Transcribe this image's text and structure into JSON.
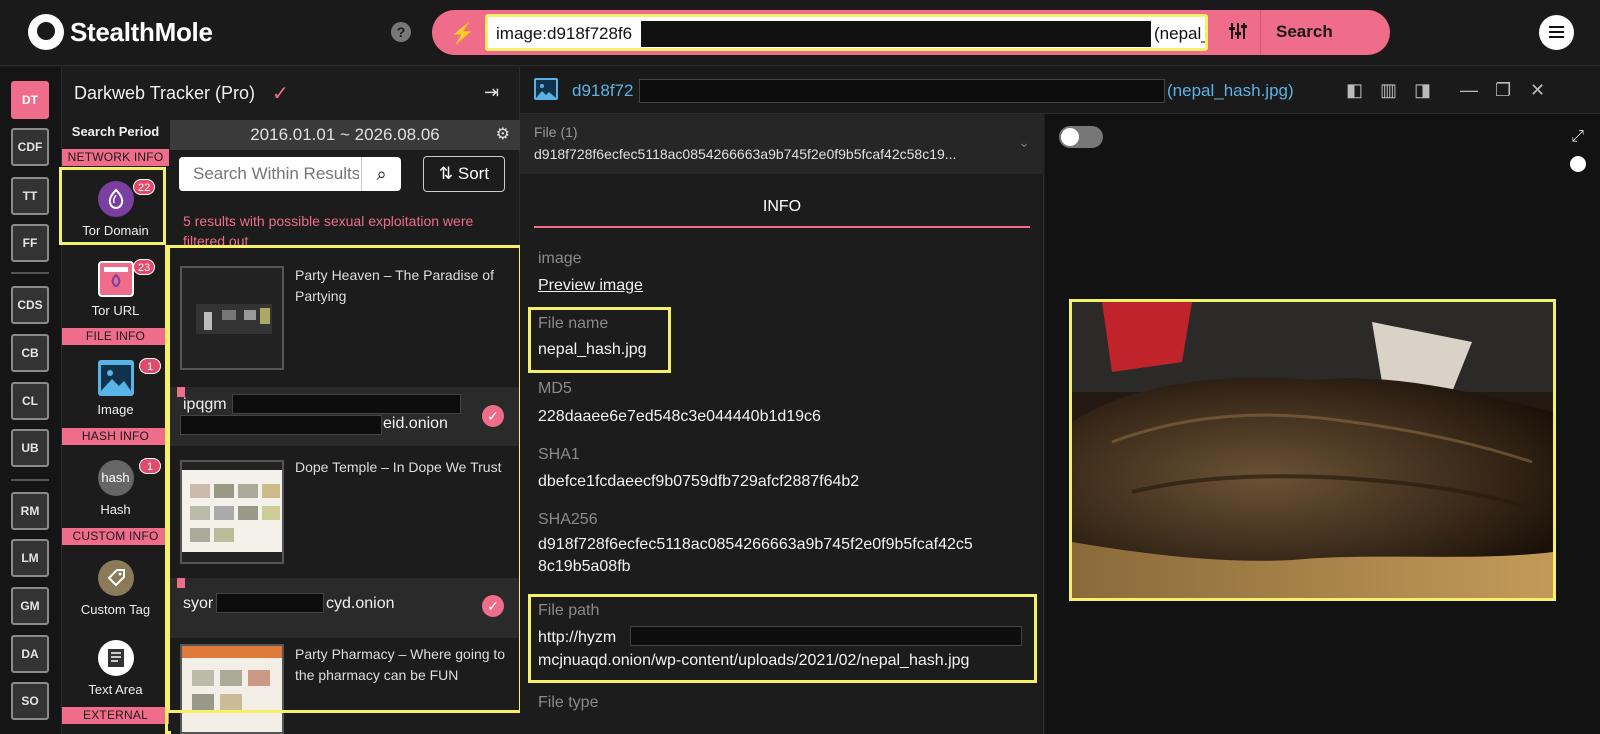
{
  "app": {
    "name": "StealthMole",
    "help_icon": "help-circle-icon",
    "menu_icon": "hamburger-icon"
  },
  "search": {
    "query_visible_start": "image:d918f728f6",
    "query_visible_end": "(nepal_l",
    "button": "Search",
    "mode_icon": "lightning-icon",
    "filter_icon": "sliders-icon"
  },
  "leftnav": [
    "DT",
    "CDF",
    "TT",
    "FF",
    "CDS",
    "CB",
    "CL",
    "UB",
    "RM",
    "LM",
    "GM",
    "DA",
    "SO"
  ],
  "panel": {
    "title": "Darkweb Tracker (Pro)",
    "search_period_label": "Search Period",
    "search_period": "2016.01.01 ~ 2026.08.06",
    "sections": {
      "network": "NETWORK INFO",
      "file": "FILE INFO",
      "hash": "HASH INFO",
      "custom": "CUSTOM INFO",
      "external": "EXTERNAL"
    },
    "categories": [
      {
        "label": "Tor Domain",
        "count": "22",
        "icon": "tor-onion-icon"
      },
      {
        "label": "Tor URL",
        "count": "23",
        "icon": "tor-browser-window-icon"
      },
      {
        "label": "Image",
        "count": "1",
        "icon": "image-icon"
      },
      {
        "label": "Hash",
        "count": "1",
        "icon": "hash-icon",
        "icon_text": "hash"
      },
      {
        "label": "Custom Tag",
        "icon": "tag-icon"
      },
      {
        "label": "Text Area",
        "icon": "text-area-icon"
      }
    ],
    "search_placeholder": "Search Within Results",
    "sort_label": "Sort",
    "warning": "5 results with possible sexual exploitation were filtered out",
    "results": [
      {
        "title": "Party Heaven – The Paradise of Partying",
        "domain_start": "ipqgm",
        "domain_end": "eid.onion"
      },
      {
        "title": "Dope Temple – In Dope We Trust",
        "domain_start": "syor",
        "domain_end": "cyd.onion"
      },
      {
        "title": "Party Pharmacy – Where going to the pharmacy can be FUN"
      }
    ]
  },
  "detail": {
    "header_hash_start": "d918f72",
    "header_filename": "(nepal_hash.jpg)",
    "file_label": "File (1)",
    "file_value": "d918f728f6ecfec5118ac0854266663a9b745f2e0f9b5fcaf42c58c19...",
    "tab": "INFO",
    "fields": {
      "image_label": "image",
      "image_link": "Preview image",
      "filename_label": "File name",
      "filename": "nepal_hash.jpg",
      "md5_label": "MD5",
      "md5": "228daaee6e7ed548c3e044440b1d19c6",
      "sha1_label": "SHA1",
      "sha1": "dbefce1fcdaeecf9b0759dfb729afcf2887f64b2",
      "sha256_label": "SHA256",
      "sha256_line1": "d918f728f6ecfec5118ac0854266663a9b745f2e0f9b5fcaf42c5",
      "sha256_line2": "8c19b5a08fb",
      "filepath_label": "File path",
      "filepath_line1_start": "http://hyzm",
      "filepath_line2": "mcjnuaqd.onion/wp-content/uploads/2021/02/nepal_hash.jpg",
      "filetype_label": "File type"
    }
  },
  "colors": {
    "accent": "#ef6d8a",
    "highlight": "#f5f06a",
    "link_blue": "#5ab3e6",
    "bg": "#1c1c1c"
  }
}
